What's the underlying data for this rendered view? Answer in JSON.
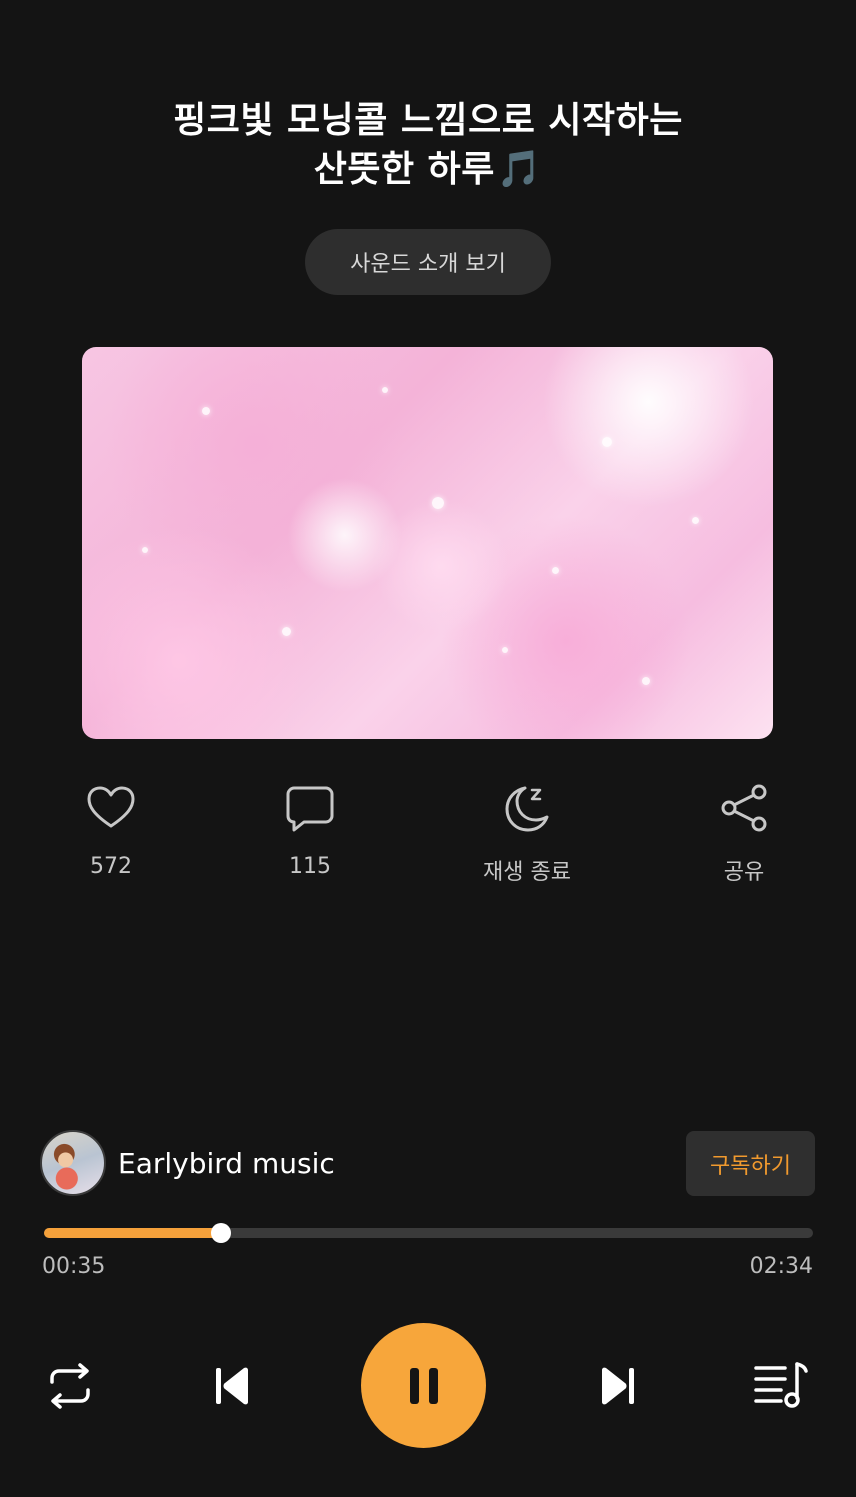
{
  "title": {
    "line1": "핑크빛 모닝콜 느낌으로 시작하는",
    "line2": "산뜻한 하루",
    "emoji": "🎵"
  },
  "intro_button": "사운드 소개 보기",
  "actions": {
    "like_count": "572",
    "comment_count": "115",
    "sleep_timer_label": "재생 종료",
    "share_label": "공유"
  },
  "channel": {
    "name": "Earlybird music",
    "subscribe_label": "구독하기"
  },
  "player": {
    "current_time": "00:35",
    "total_time": "02:34",
    "progress_fraction": 0.23
  },
  "icons": {
    "like": "heart-icon",
    "comment": "comment-icon",
    "sleep": "moon-zz-icon",
    "share": "share-icon",
    "repeat": "repeat-icon",
    "previous": "skip-previous-icon",
    "pause": "pause-icon",
    "next": "skip-next-icon",
    "playlist": "playlist-icon"
  },
  "colors": {
    "background": "#141414",
    "accent": "#f7a63b",
    "subscribe_text": "#f19a2e",
    "muted_text": "#c7c7c7"
  }
}
